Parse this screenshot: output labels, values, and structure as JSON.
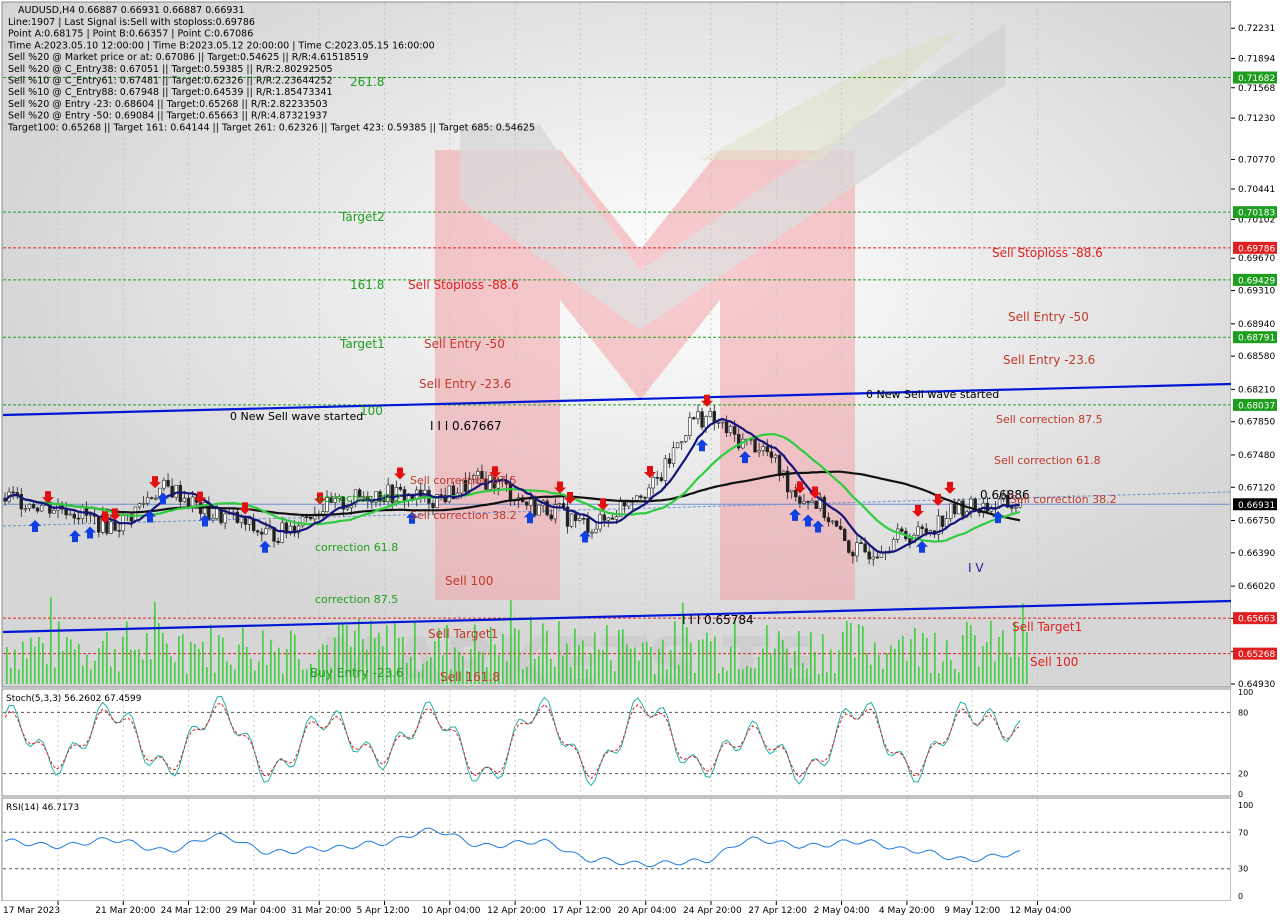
{
  "header": {
    "symbol_line": "AUDUSD,H4  0.66887 0.66931 0.66887 0.66931",
    "info_lines": [
      "Line:1907 | Last Signal is:Sell with stoploss:0.69786",
      "Point A:0.68175 | Point B:0.66357 | Point C:0.67086",
      "Time A:2023.05.10 12:00:00 | Time B:2023.05.12 20:00:00 | Time C:2023.05.15 16:00:00",
      "Sell %20 @ Market price or at: 0.67086 || Target:0.54625 || R/R:4.61518519",
      "Sell %20 @ C_Entry38: 0.67051 || Target:0.59385 || R/R:2.80292505",
      "Sell %10 @ C_Entry61: 0.67481 || Target:0.62326 || R/R:2.23644252",
      "Sell %10 @ C_Entry88: 0.67948 || Target:0.64539 || R/R:1.85473341",
      "Sell %20 @ Entry -23: 0.68604 || Target:0.65268 || R/R:2.82233503",
      "Sell %20 @ Entry -50: 0.69084 || Target:0.65663 || R/R:4.87321937",
      "Target100: 0.65268 || Target 161: 0.64144 || Target 261: 0.62326 || Target 423: 0.59385 || Target 685: 0.54625"
    ]
  },
  "price_axis": {
    "ticks": [
      "0.72231",
      "0.71894",
      "0.71568",
      "0.71230",
      "0.70770",
      "0.70441",
      "0.70102",
      "0.69670",
      "0.69310",
      "0.68940",
      "0.68580",
      "0.68210",
      "0.67850",
      "0.67480",
      "0.67120",
      "0.66750",
      "0.66390",
      "0.66020",
      "0.65660",
      "0.65290",
      "0.64930"
    ],
    "tick_values": [
      0.72231,
      0.71894,
      0.71568,
      0.7123,
      0.7077,
      0.70441,
      0.70102,
      0.6967,
      0.6931,
      0.6894,
      0.6858,
      0.6821,
      0.6785,
      0.6748,
      0.6712,
      0.6675,
      0.6639,
      0.6602,
      0.6566,
      0.6529,
      0.6493
    ],
    "badges": [
      {
        "text": "0.71682",
        "value": 0.71682,
        "color": "#1e9e1e"
      },
      {
        "text": "0.70183",
        "value": 0.70183,
        "color": "#1e9e1e"
      },
      {
        "text": "0.69786",
        "value": 0.69786,
        "color": "#e02020"
      },
      {
        "text": "0.69429",
        "value": 0.69429,
        "color": "#1e9e1e"
      },
      {
        "text": "0.68791",
        "value": 0.68791,
        "color": "#1e9e1e"
      },
      {
        "text": "0.68037",
        "value": 0.68037,
        "color": "#1e9e1e"
      },
      {
        "text": "0.66931",
        "value": 0.66931,
        "color": "#000000"
      },
      {
        "text": "0.65663",
        "value": 0.65663,
        "color": "#e02020"
      },
      {
        "text": "0.65268",
        "value": 0.65268,
        "color": "#e02020"
      }
    ]
  },
  "time_axis": {
    "labels": [
      "17 Mar 2023",
      "21 Mar 20:00",
      "24 Mar 12:00",
      "29 Mar 04:00",
      "31 Mar 20:00",
      "5 Apr 12:00",
      "10 Apr 04:00",
      "12 Apr 20:00",
      "17 Apr 12:00",
      "20 Apr 04:00",
      "24 Apr 20:00",
      "27 Apr 12:00",
      "2 May 04:00",
      "4 May 20:00",
      "9 May 12:00",
      "12 May 04:00"
    ]
  },
  "level_lines": [
    {
      "value": 0.71682,
      "color": "#1e9e1e",
      "label": "261.8",
      "label_color": "#1e9e1e"
    },
    {
      "value": 0.70183,
      "color": "#1e9e1e",
      "label": "Target2",
      "label_color": "#1e9e1e"
    },
    {
      "value": 0.69786,
      "color": "#e02020",
      "label": "Sell Stoploss -88.6",
      "label_color": "#e02020"
    },
    {
      "value": 0.69429,
      "color": "#1e9e1e",
      "label": "",
      "label_color": "#1e9e1e"
    },
    {
      "value": 0.68791,
      "color": "#1e9e1e",
      "label": "Sell Entry -50",
      "label_color": "#c0392b"
    },
    {
      "value": 0.68037,
      "color": "#1e9e1e",
      "label": "",
      "label_color": "#1e9e1e"
    },
    {
      "value": 0.65663,
      "color": "#e02020",
      "label": "Sell Target1",
      "label_color": "#e02020"
    },
    {
      "value": 0.65268,
      "color": "#e02020",
      "label": "Sell 100",
      "label_color": "#e02020"
    }
  ],
  "chart_labels": [
    {
      "text": "161.8",
      "color": "#1e9e1e"
    },
    {
      "text": "Sell Stoploss -88.6",
      "color": "#e02020"
    },
    {
      "text": "Target1",
      "color": "#1e9e1e"
    },
    {
      "text": "Sell Entry -50",
      "color": "#c0392b"
    },
    {
      "text": "Sell Entry -23.6",
      "color": "#c0392b"
    },
    {
      "text": "100",
      "color": "#1e9e1e"
    },
    {
      "text": "0 New Sell wave started",
      "color": "#000000"
    },
    {
      "text": "I I I 0.67667",
      "color": "#000000"
    },
    {
      "text": "Sell correction 87.5",
      "color": "#c0392b"
    },
    {
      "text": "Sell correction 38.2",
      "color": "#c0392b"
    },
    {
      "text": "correction 38.2",
      "color": "#1e9e1e"
    },
    {
      "text": "correction 61.8",
      "color": "#1e9e1e"
    },
    {
      "text": "correction 87.5",
      "color": "#1e9e1e"
    },
    {
      "text": "Sell 100",
      "color": "#c0392b"
    },
    {
      "text": "Sell Target1",
      "color": "#c0392b"
    },
    {
      "text": "Buy Entry -23.6",
      "color": "#1e9e1e"
    },
    {
      "text": "Sell 161.8",
      "color": "#c0392b"
    },
    {
      "text": "I I I 0.65784",
      "color": "#000000"
    },
    {
      "text": "0 New Sell wave started",
      "color": "#000000"
    },
    {
      "text": "Sell Entry -23.6",
      "color": "#c0392b"
    },
    {
      "text": "Sell correction 87.5",
      "color": "#c0392b"
    },
    {
      "text": "Sell correction 61.8",
      "color": "#c0392b"
    },
    {
      "text": "0.66886",
      "color": "#000000"
    },
    {
      "text": "Sell correction 38.2",
      "color": "#c0392b"
    },
    {
      "text": "I V",
      "color": "#1a1a9e"
    }
  ],
  "stoch": {
    "label": "Stoch(5,3,3) 56.2602 67.4599",
    "ticks": [
      "100",
      "80",
      "20",
      "0"
    ],
    "tick_values": [
      100,
      80,
      20,
      0
    ]
  },
  "rsi": {
    "label": "RSI(14) 46.7173",
    "ticks": [
      "100",
      "70",
      "30",
      "0"
    ],
    "tick_values": [
      100,
      70,
      30,
      0
    ]
  },
  "colors": {
    "background": "#ffffff",
    "trend_line": "#0018d6",
    "ma_black": "#111111",
    "ma_green": "#2ecc40",
    "ma_navy": "#141478",
    "sell_arrow": "#e01010",
    "buy_arrow": "#1040e0",
    "volume": "#22cc22",
    "stoch_main": "#20b2aa",
    "stoch_signal": "#e02020",
    "rsi": "#1e7be0",
    "current_price_line": "#7090d0",
    "watermark": "#f0a0a8"
  },
  "chart_data": {
    "type": "line",
    "title": "AUDUSD,H4",
    "x": [
      "17 Mar 2023",
      "21 Mar 20:00",
      "24 Mar 12:00",
      "29 Mar 04:00",
      "31 Mar 20:00",
      "5 Apr 12:00",
      "10 Apr 04:00",
      "12 Apr 20:00",
      "17 Apr 12:00",
      "20 Apr 04:00",
      "24 Apr 20:00",
      "27 Apr 12:00",
      "2 May 04:00",
      "4 May 20:00",
      "9 May 12:00",
      "12 May 04:00"
    ],
    "series": [
      {
        "values": [
          0.669,
          0.6665,
          0.6705,
          0.668,
          0.6735,
          0.67,
          0.665,
          0.67,
          0.6712,
          0.6705,
          0.6625,
          0.661,
          0.6665,
          0.675,
          0.676,
          0.666
        ]
      }
    ],
    "close_series": [
      0.67,
      0.669,
      0.667,
      0.671,
      0.668,
      0.666,
      0.669,
      0.6705,
      0.67,
      0.672,
      0.669,
      0.667,
      0.671,
      0.679,
      0.676,
      0.67,
      0.664,
      0.666,
      0.669,
      0.66931
    ],
    "ylim": [
      0.6493,
      0.723
    ],
    "levels": {
      "target_261_8": 0.71682,
      "target2": 0.70183,
      "sell_stoploss": 0.69786,
      "sell_entry_50": 0.68791,
      "sell_entry_23_6": 0.68037,
      "current_price": 0.66931,
      "sell_target1": 0.65663,
      "sell_100": 0.65268
    },
    "stoch_values": [
      78,
      30,
      82,
      25,
      85,
      20,
      75,
      35,
      80,
      15,
      85,
      20,
      88,
      25,
      60,
      20,
      85,
      22,
      80,
      60
    ],
    "rsi_values": [
      60,
      55,
      62,
      50,
      66,
      48,
      52,
      58,
      72,
      55,
      60,
      40,
      35,
      38,
      62,
      55,
      60,
      50,
      40,
      47
    ]
  }
}
